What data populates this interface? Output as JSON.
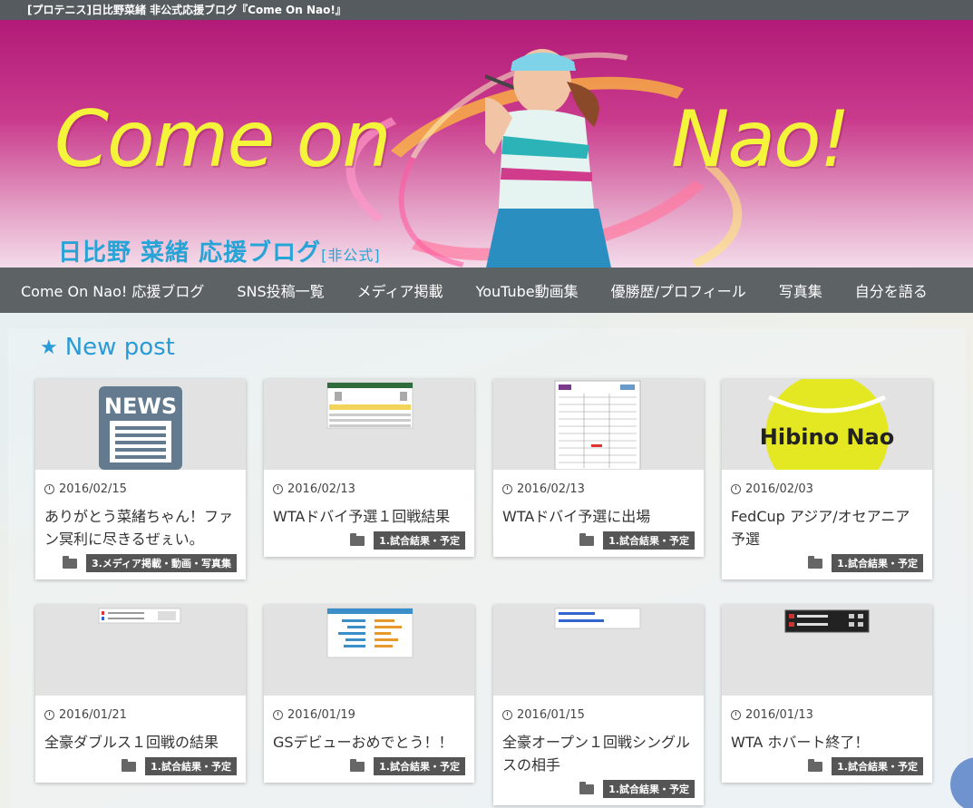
{
  "topbar": {
    "title": "[プロテニス]日比野菜緒 非公式応援ブログ『Come On Nao!』"
  },
  "banner": {
    "title_left": "Come on",
    "title_right": "Nao!",
    "subtitle": "日比野 菜緒  応援ブログ",
    "subtitle_tag": "[非公式]"
  },
  "nav": {
    "items": [
      "Come On Nao! 応援ブログ",
      "SNS投稿一覧",
      "メディア掲載",
      "YouTube動画集",
      "優勝歴/プロフィール",
      "写真集",
      "自分を語る"
    ]
  },
  "section": {
    "title": "New post",
    "icon": "star-icon"
  },
  "posts": [
    {
      "date": "2016/02/15",
      "title": "ありがとう菜緒ちゃん！ファン冥利に尽きるぜぇい。",
      "category": "3.メディア掲載・動画・写真集",
      "thumb": "news-icon",
      "thumb_text": "NEWS"
    },
    {
      "date": "2016/02/13",
      "title": "WTAドバイ予選１回戦結果",
      "category": "1.試合結果・予定",
      "thumb": "scoreboard"
    },
    {
      "date": "2016/02/13",
      "title": "WTAドバイ予選に出場",
      "category": "1.試合結果・予定",
      "thumb": "draw-sheet"
    },
    {
      "date": "2016/02/03",
      "title": "FedCup アジア/オセアニア予選",
      "category": "1.試合結果・予定",
      "thumb": "tennis-ball",
      "thumb_text": "Hibino Nao"
    },
    {
      "date": "2016/01/21",
      "title": "全豪ダブルス１回戦の結果",
      "category": "1.試合結果・予定",
      "thumb": "score-table"
    },
    {
      "date": "2016/01/19",
      "title": "GSデビューおめでとう！！",
      "category": "1.試合結果・予定",
      "thumb": "stats"
    },
    {
      "date": "2016/01/15",
      "title": "全豪オープン１回戦シングルスの相手",
      "category": "1.試合結果・予定",
      "thumb": "list-card"
    },
    {
      "date": "2016/01/13",
      "title": "WTA ホバート終了！",
      "category": "1.試合結果・予定",
      "thumb": "dark-scoreboard"
    }
  ]
}
